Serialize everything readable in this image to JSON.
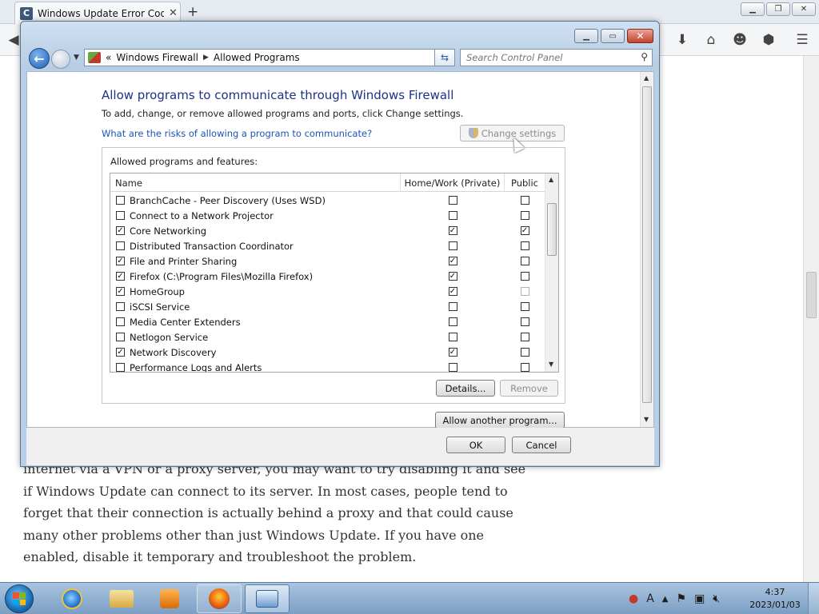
{
  "browser": {
    "tab_title": "Windows Update Error Cod...",
    "tab_favicon_letter": "C",
    "new_tab": "+",
    "article_paragraph": "internet via a VPN or a proxy server, you may want to try disabling it and see if Windows Update can connect to its server. In most cases, people tend to forget that their connection is actually behind a proxy and that could cause many other problems other than just Windows Update. If you have one enabled, disable it temporary and troubleshoot the problem."
  },
  "dialog": {
    "breadcrumb": [
      "Windows Firewall",
      "Allowed Programs"
    ],
    "breadcrumb_prefix": "«",
    "search_placeholder": "Search Control Panel",
    "heading": "Allow programs to communicate through Windows Firewall",
    "subtext": "To add, change, or remove allowed programs and ports, click Change settings.",
    "risk_link": "What are the risks of allowing a program to communicate?",
    "change_settings_label": "Change settings",
    "group_label": "Allowed programs and features:",
    "columns": {
      "name": "Name",
      "private": "Home/Work (Private)",
      "public": "Public"
    },
    "programs": [
      {
        "name": "BranchCache - Peer Discovery (Uses WSD)",
        "enabled": false,
        "private": false,
        "public": false,
        "public_dimmed": false
      },
      {
        "name": "Connect to a Network Projector",
        "enabled": false,
        "private": false,
        "public": false,
        "public_dimmed": false
      },
      {
        "name": "Core Networking",
        "enabled": true,
        "private": true,
        "public": true,
        "public_dimmed": false
      },
      {
        "name": "Distributed Transaction Coordinator",
        "enabled": false,
        "private": false,
        "public": false,
        "public_dimmed": false
      },
      {
        "name": "File and Printer Sharing",
        "enabled": true,
        "private": true,
        "public": false,
        "public_dimmed": false
      },
      {
        "name": "Firefox (C:\\Program Files\\Mozilla Firefox)",
        "enabled": true,
        "private": true,
        "public": false,
        "public_dimmed": false
      },
      {
        "name": "HomeGroup",
        "enabled": true,
        "private": true,
        "public": false,
        "public_dimmed": true
      },
      {
        "name": "iSCSI Service",
        "enabled": false,
        "private": false,
        "public": false,
        "public_dimmed": false
      },
      {
        "name": "Media Center Extenders",
        "enabled": false,
        "private": false,
        "public": false,
        "public_dimmed": false
      },
      {
        "name": "Netlogon Service",
        "enabled": false,
        "private": false,
        "public": false,
        "public_dimmed": false
      },
      {
        "name": "Network Discovery",
        "enabled": true,
        "private": true,
        "public": false,
        "public_dimmed": false
      },
      {
        "name": "Performance Logs and Alerts",
        "enabled": false,
        "private": false,
        "public": false,
        "public_dimmed": false
      }
    ],
    "details_label": "Details...",
    "remove_label": "Remove",
    "allow_another_label": "Allow another program...",
    "ok_label": "OK",
    "cancel_label": "Cancel"
  },
  "taskbar": {
    "apps": [
      "internet-explorer",
      "windows-explorer",
      "media-player",
      "firefox",
      "control-panel"
    ],
    "tray_language": "A",
    "clock_time": "4:37",
    "clock_date": "2023/01/03"
  },
  "colors": {
    "heading_blue": "#1e3287",
    "link_blue": "#1c55b5",
    "dialog_frame": "#b7cfe7"
  }
}
